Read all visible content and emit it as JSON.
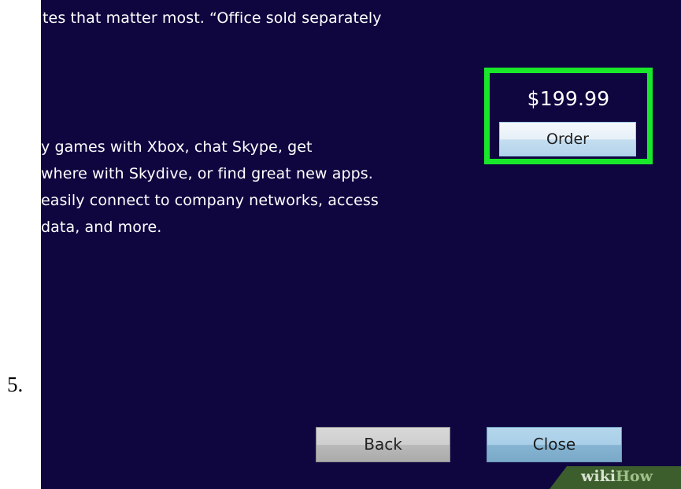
{
  "step": {
    "number": "5."
  },
  "description": {
    "top_line": "tes that matter most. “Office sold separately",
    "lines": [
      "y games with Xbox, chat Skype, get",
      "where with Skydive, or find great new apps.",
      "easily connect to company networks, access",
      "data, and more."
    ]
  },
  "price_panel": {
    "price": "$199.99",
    "order_label": "Order",
    "highlight_color": "#19e82a"
  },
  "footer": {
    "back_label": "Back",
    "close_label": "Close"
  },
  "watermark": {
    "wiki": "wiki",
    "how": "How"
  },
  "colors": {
    "screen_background": "#0f0640",
    "text": "#ffffff"
  }
}
